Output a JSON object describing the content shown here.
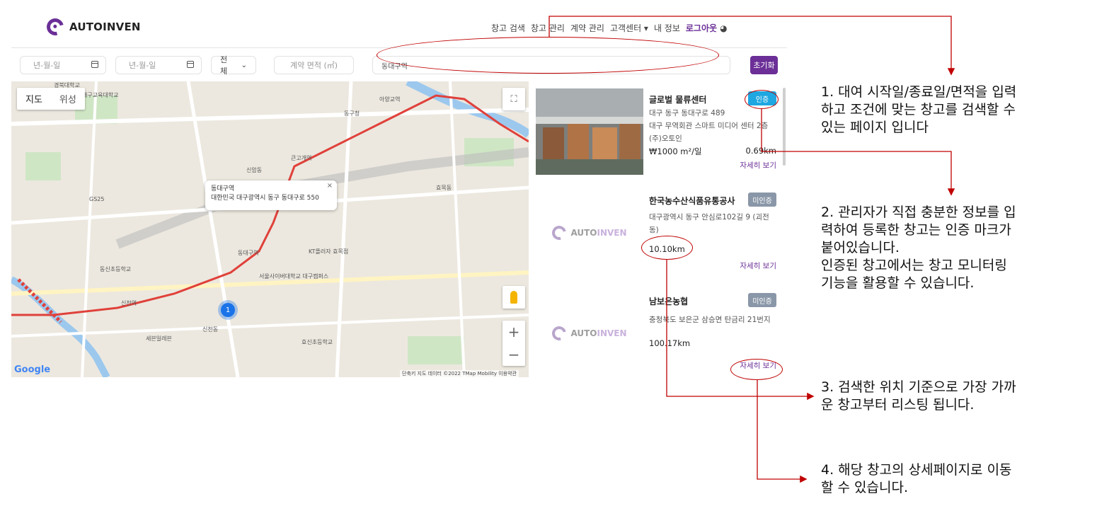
{
  "header": {
    "logo_text_prefix": "AUTO",
    "logo_text_suffix": "INVEN",
    "nav": [
      "창고 검색",
      "창고 관리",
      "계약 관리",
      "고객센터 ▾",
      "내 정보"
    ],
    "logout": "로그아웃",
    "globe": "◕"
  },
  "filters": {
    "start_date_placeholder": "년-월-일",
    "end_date_placeholder": "년-월-일",
    "type_select": "전체",
    "area_placeholder": "계약 면적 (㎡)",
    "location_value": "동대구역",
    "reset_label": "초기화"
  },
  "map": {
    "toggle_map": "지도",
    "toggle_satellite": "위성",
    "infowindow_title": "동대구역",
    "infowindow_address": "대한민국 대구광역시 동구 동대구로 550",
    "cluster_count": "1",
    "google": "Google",
    "footer": "단축키   지도 데이터 ©2022 TMap Mobility   이용약관",
    "labels": [
      "경북대학교",
      "대구교육대학교",
      "신암동",
      "동대구역",
      "효목동",
      "신천동",
      "동구청",
      "아양교역",
      "세븐일레븐",
      "GS25",
      "큰고개역",
      "신천역",
      "KT플러자 효목점",
      "서울사이버대학교 대구캠퍼스",
      "동신초등학교",
      "효신초등학교"
    ]
  },
  "listings": [
    {
      "name": "글로벌 물류센터",
      "badge": "인증",
      "address1": "대구 동구 동대구로 489",
      "address2": "대구 무역회관 스마트 미디어 센터 2층",
      "company": "(주)오토인",
      "price": "₩1000 m²/일",
      "distance": "0.69km",
      "more": "자세히 보기"
    },
    {
      "name": "한국농수산식품유통공사",
      "badge": "미인증",
      "address1": "대구광역시 동구 안심로102길 9 (괴전",
      "address2": "동)",
      "distance": "10.10km",
      "more": "자세히 보기"
    },
    {
      "name": "남보은농협",
      "badge": "미인증",
      "address1": "충청북도 보은군 삼승면 탄금리 21번지",
      "distance": "100.17km",
      "more": "자세히 보기"
    }
  ],
  "placeholder_logo": {
    "prefix": "AUTO",
    "suffix": "INVEN"
  },
  "annotations": {
    "note1": [
      "1. 대여 시작일/종료일/면적을 입력",
      "하고 조건에 맞는 창고를 검색할 수",
      "있는 페이지 입니다"
    ],
    "note2": [
      "2. 관리자가 직접 충분한 정보를 입",
      "력하여 등록한 창고는 인증 마크가",
      "붙어있습니다.",
      "인증된 창고에서는 창고 모니터링",
      "기능을 활용할 수 있습니다."
    ],
    "note3": [
      "3. 검색한 위치 기준으로 가장 가까",
      "운 창고부터 리스팅 됩니다."
    ],
    "note4": [
      "4. 해당 창고의 상세페이지로 이동",
      "할 수 있습니다."
    ]
  },
  "colors": {
    "brand": "#6b2f97",
    "certified": "#1ea7e1",
    "uncertified": "#8a97a8",
    "annotation": "#c00000"
  }
}
